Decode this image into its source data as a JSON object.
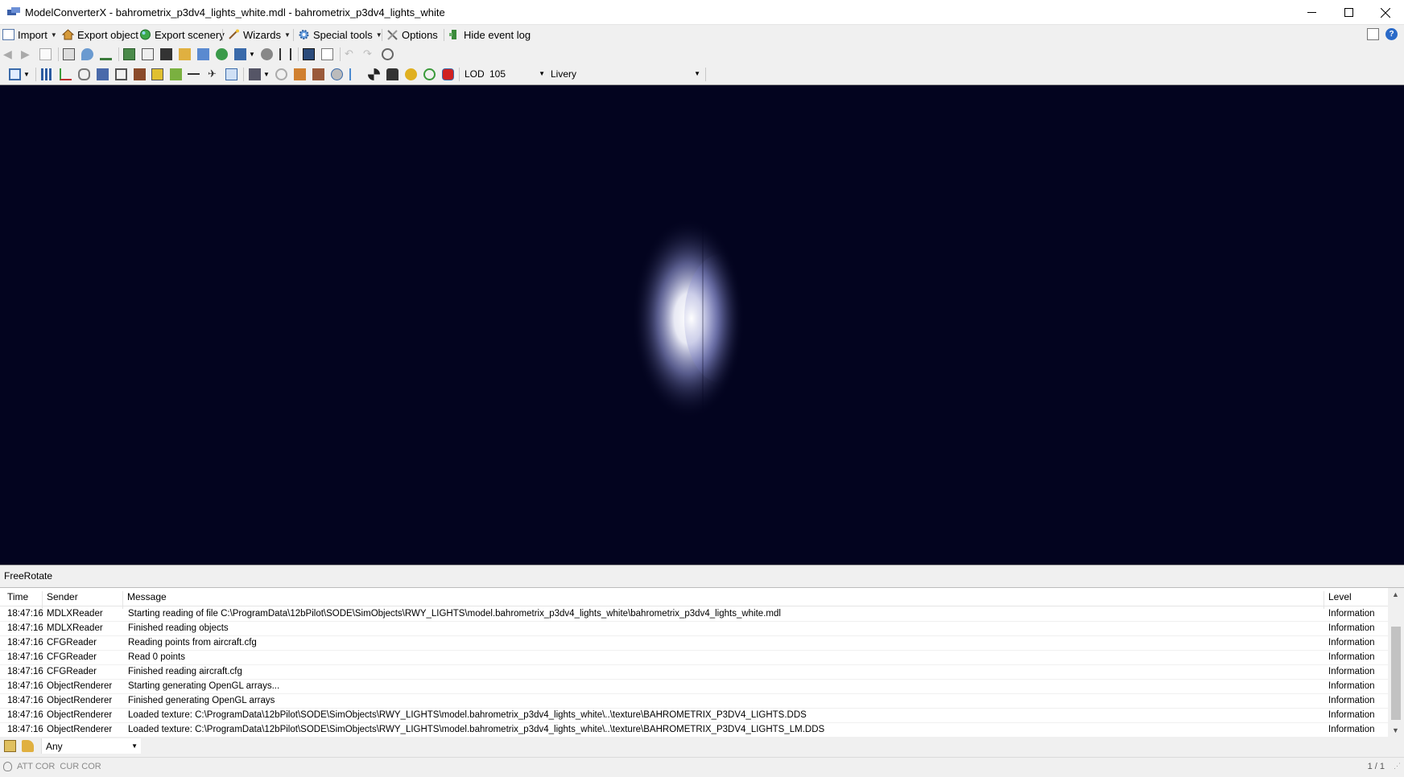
{
  "window": {
    "title": "ModelConverterX - bahrometrix_p3dv4_lights_white.mdl - bahrometrix_p3dv4_lights_white"
  },
  "menu": {
    "import": "Import",
    "export_object": "Export object",
    "export_scenery": "Export scenery",
    "wizards": "Wizards",
    "special_tools": "Special tools",
    "options": "Options",
    "hide_event_log": "Hide event log"
  },
  "toolbar3": {
    "lod_label": "LOD",
    "lod_value": "105",
    "livery_label": "Livery",
    "livery_value": ""
  },
  "viewport": {
    "mode": "FreeRotate",
    "background": "#03041f"
  },
  "log": {
    "columns": {
      "time": "Time",
      "sender": "Sender",
      "message": "Message",
      "level": "Level"
    },
    "rows": [
      {
        "time": "18:47:16",
        "sender": "MDLXReader",
        "message": "Starting reading of file C:\\ProgramData\\12bPilot\\SODE\\SimObjects\\RWY_LIGHTS\\model.bahrometrix_p3dv4_lights_white\\bahrometrix_p3dv4_lights_white.mdl",
        "level": "Information"
      },
      {
        "time": "18:47:16",
        "sender": "MDLXReader",
        "message": "Finished reading objects",
        "level": "Information"
      },
      {
        "time": "18:47:16",
        "sender": "CFGReader",
        "message": "Reading points from aircraft.cfg",
        "level": "Information"
      },
      {
        "time": "18:47:16",
        "sender": "CFGReader",
        "message": "Read 0 points",
        "level": "Information"
      },
      {
        "time": "18:47:16",
        "sender": "CFGReader",
        "message": "Finished reading aircraft.cfg",
        "level": "Information"
      },
      {
        "time": "18:47:16",
        "sender": "ObjectRenderer",
        "message": "Starting generating OpenGL arrays...",
        "level": "Information"
      },
      {
        "time": "18:47:16",
        "sender": "ObjectRenderer",
        "message": "Finished generating OpenGL arrays",
        "level": "Information"
      },
      {
        "time": "18:47:16",
        "sender": "ObjectRenderer",
        "message": "Loaded texture: C:\\ProgramData\\12bPilot\\SODE\\SimObjects\\RWY_LIGHTS\\model.bahrometrix_p3dv4_lights_white\\..\\texture\\BAHROMETRIX_P3DV4_LIGHTS.DDS",
        "level": "Information"
      },
      {
        "time": "18:47:16",
        "sender": "ObjectRenderer",
        "message": "Loaded texture: C:\\ProgramData\\12bPilot\\SODE\\SimObjects\\RWY_LIGHTS\\model.bahrometrix_p3dv4_lights_white\\..\\texture\\BAHROMETRIX_P3DV4_LIGHTS_LM.DDS",
        "level": "Information"
      }
    ]
  },
  "filter": {
    "value": "Any"
  },
  "status": {
    "left": "ATT COR  CUR COR",
    "right": "1 / 1"
  }
}
